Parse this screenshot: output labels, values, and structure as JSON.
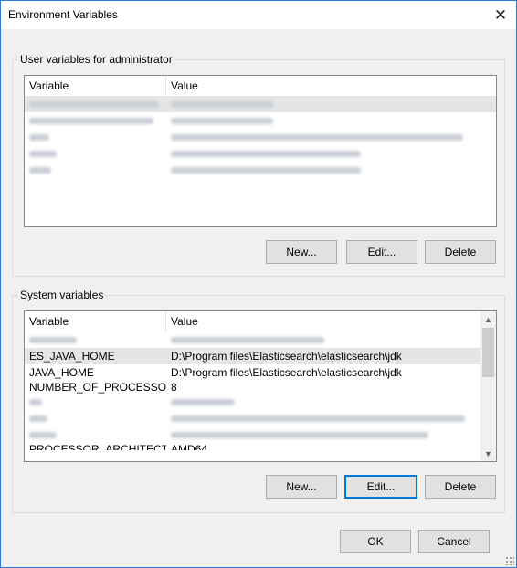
{
  "window": {
    "title": "Environment Variables",
    "close_symbol": "✕"
  },
  "user_section": {
    "label": "User variables for administrator",
    "columns": [
      "Variable",
      "Value"
    ],
    "rows": [
      {
        "name": "",
        "value": ""
      },
      {
        "name": "",
        "value": ""
      },
      {
        "name": "",
        "value": ""
      },
      {
        "name": "",
        "value": ""
      },
      {
        "name": "",
        "value": ""
      }
    ],
    "buttons": {
      "new": "New...",
      "edit": "Edit...",
      "delete": "Delete"
    }
  },
  "system_section": {
    "label": "System variables",
    "columns": [
      "Variable",
      "Value"
    ],
    "rows": [
      {
        "name": "",
        "value": ""
      },
      {
        "name": "ES_JAVA_HOME",
        "value": "D:\\Program files\\Elasticsearch\\elasticsearch\\jdk"
      },
      {
        "name": "JAVA_HOME",
        "value": "D:\\Program files\\Elasticsearch\\elasticsearch\\jdk"
      },
      {
        "name": "NUMBER_OF_PROCESSORS",
        "value": "8"
      },
      {
        "name": "",
        "value": ""
      },
      {
        "name": "",
        "value": ""
      },
      {
        "name": "",
        "value": ""
      },
      {
        "name": "PROCESSOR_ARCHITECTU...",
        "value": "AMD64"
      }
    ],
    "selected_row": 1,
    "buttons": {
      "new": "New...",
      "edit": "Edit...",
      "delete": "Delete"
    }
  },
  "footer": {
    "ok": "OK",
    "cancel": "Cancel"
  },
  "colors": {
    "border_accent": "#2b79d8",
    "focus": "#0078d7",
    "selection": "#e5e5e5"
  },
  "icons": {
    "close": "close-icon",
    "scroll_up": "chevron-up-icon",
    "scroll_down": "chevron-down-icon",
    "resize": "resize-grip-icon"
  }
}
